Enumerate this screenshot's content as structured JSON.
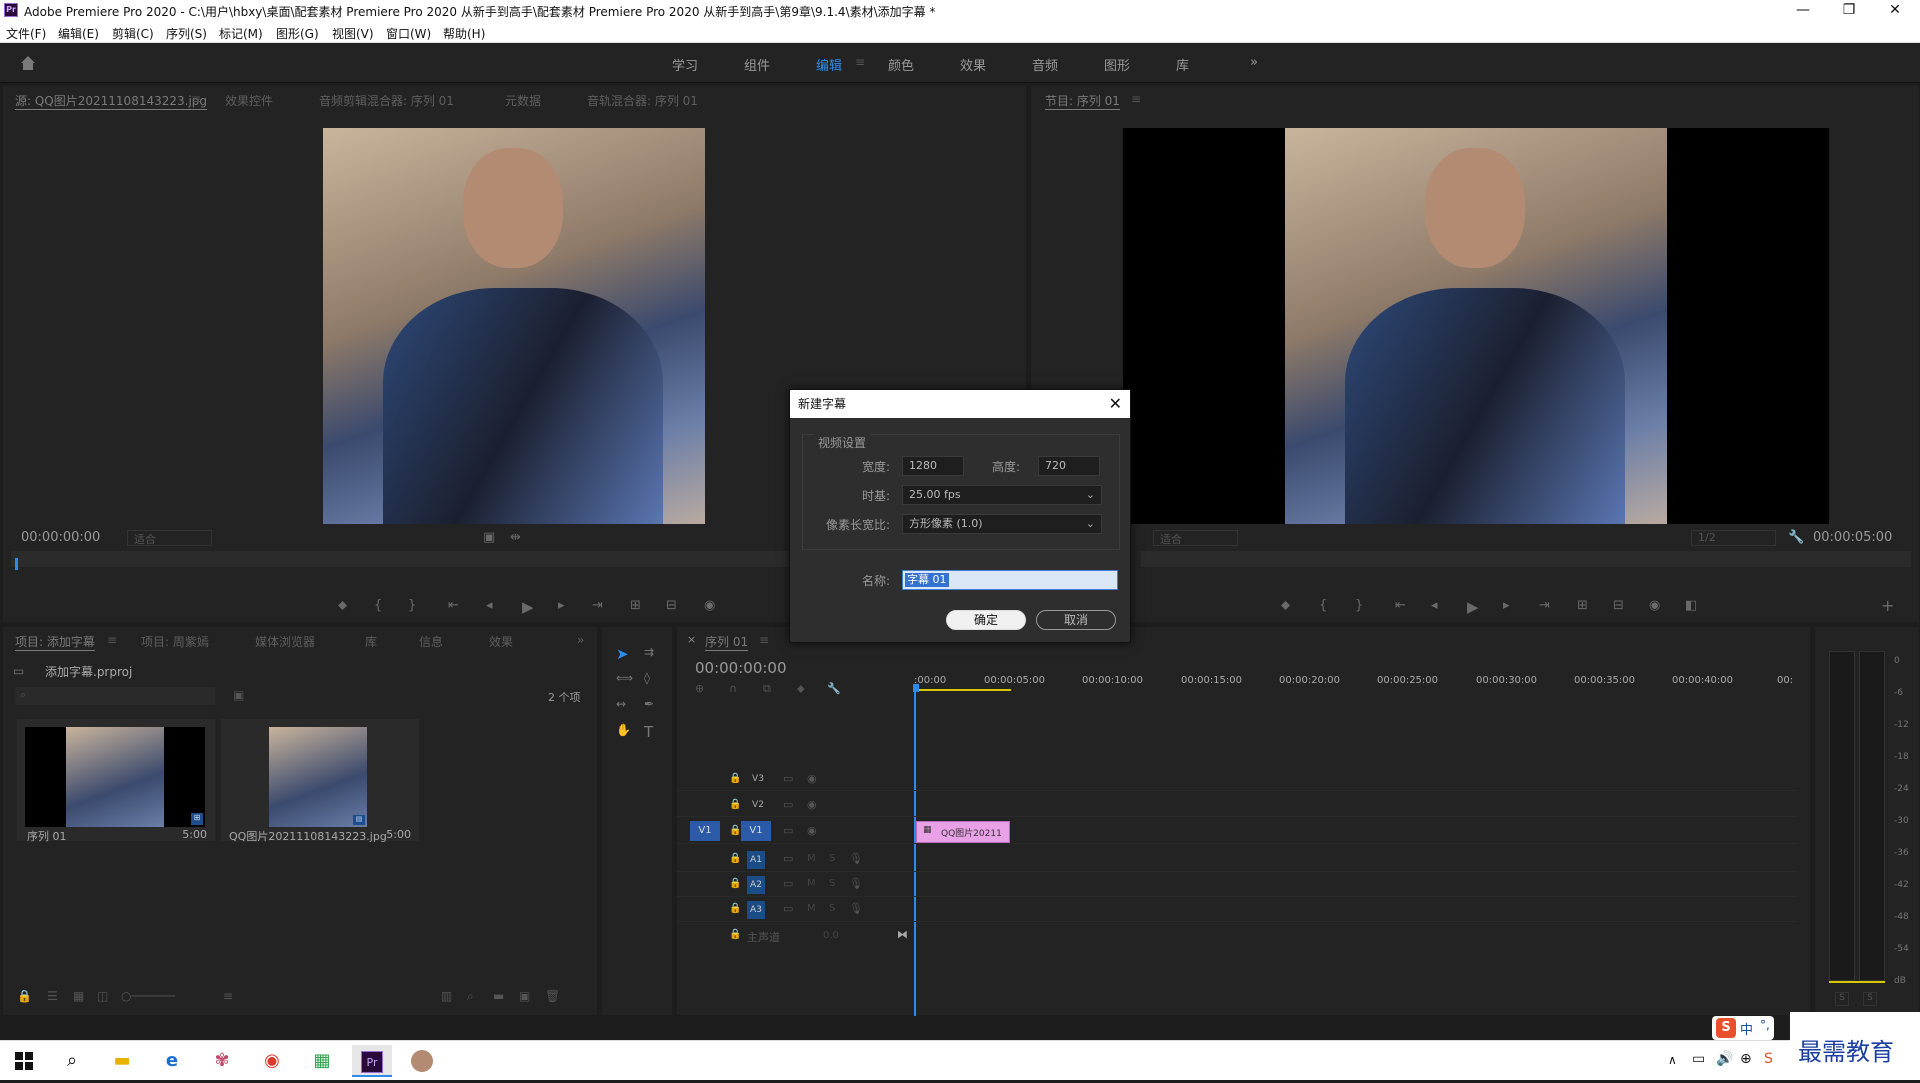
{
  "window": {
    "title": "Adobe Premiere Pro 2020 - C:\\用户\\hbxy\\桌面\\配套素材 Premiere Pro 2020 从新手到高手\\配套素材 Premiere Pro 2020 从新手到高手\\第9章\\9.1.4\\素材\\添加字幕 *",
    "logo": "Pr"
  },
  "menu": [
    "文件(F)",
    "编辑(E)",
    "剪辑(C)",
    "序列(S)",
    "标记(M)",
    "图形(G)",
    "视图(V)",
    "窗口(W)",
    "帮助(H)"
  ],
  "workspaces": [
    "学习",
    "组件",
    "编辑",
    "颜色",
    "效果",
    "音频",
    "图形",
    "库"
  ],
  "active_workspace": "编辑",
  "source_panel": {
    "tabs": [
      "源: QQ图片20211108143223.jpg",
      "效果控件",
      "音频剪辑混合器: 序列 01",
      "元数据",
      "音轨混合器: 序列 01"
    ],
    "timecode": "00:00:00:00",
    "fit": "适合"
  },
  "program_panel": {
    "tab": "节目: 序列 01",
    "fit": "适合",
    "quality": "1/2",
    "timecode": "00:00:05:00"
  },
  "project_panel": {
    "tabs": [
      "项目: 添加字幕",
      "项目: 周紫嫣",
      "媒体浏览器",
      "库",
      "信息",
      "效果"
    ],
    "file": "添加字幕.prproj",
    "count": "2 个项",
    "items": [
      {
        "name": "序列 01",
        "duration": "5:00"
      },
      {
        "name": "QQ图片20211108143223.jpg",
        "duration": "5:00"
      }
    ]
  },
  "timeline": {
    "tab": "序列 01",
    "timecode": "00:00:00:00",
    "ruler": [
      ":00:00",
      "00:00:05:00",
      "00:00:10:00",
      "00:00:15:00",
      "00:00:20:00",
      "00:00:25:00",
      "00:00:30:00",
      "00:00:35:00",
      "00:00:40:00",
      "00:"
    ],
    "video_tracks": [
      "V3",
      "V2",
      "V1"
    ],
    "audio_tracks": [
      "A1",
      "A2",
      "A3"
    ],
    "source_v": "V1",
    "master": "主声道",
    "master_val": "0.0",
    "clip": "QQ图片20211",
    "mute": "M",
    "solo": "S"
  },
  "meter": {
    "ticks": [
      "0",
      "-6",
      "-12",
      "-18",
      "-24",
      "-30",
      "-36",
      "-42",
      "-48",
      "-54",
      "dB"
    ],
    "solo": "S"
  },
  "dialog": {
    "title": "新建字幕",
    "section": "视频设置",
    "width_label": "宽度:",
    "width_value": "1280",
    "height_label": "高度:",
    "height_value": "720",
    "timebase_label": "时基:",
    "timebase_value": "25.00 fps",
    "par_label": "像素长宽比:",
    "par_value": "方形像素 (1.0)",
    "name_label": "名称:",
    "name_value": "字幕 01",
    "ok": "确定",
    "cancel": "取消"
  },
  "tray": {
    "ime": "中",
    "watermark": "最需教育"
  },
  "colors": {
    "accent": "#2d8ceb",
    "panel": "#232323",
    "clip": "#e8a0e6"
  }
}
